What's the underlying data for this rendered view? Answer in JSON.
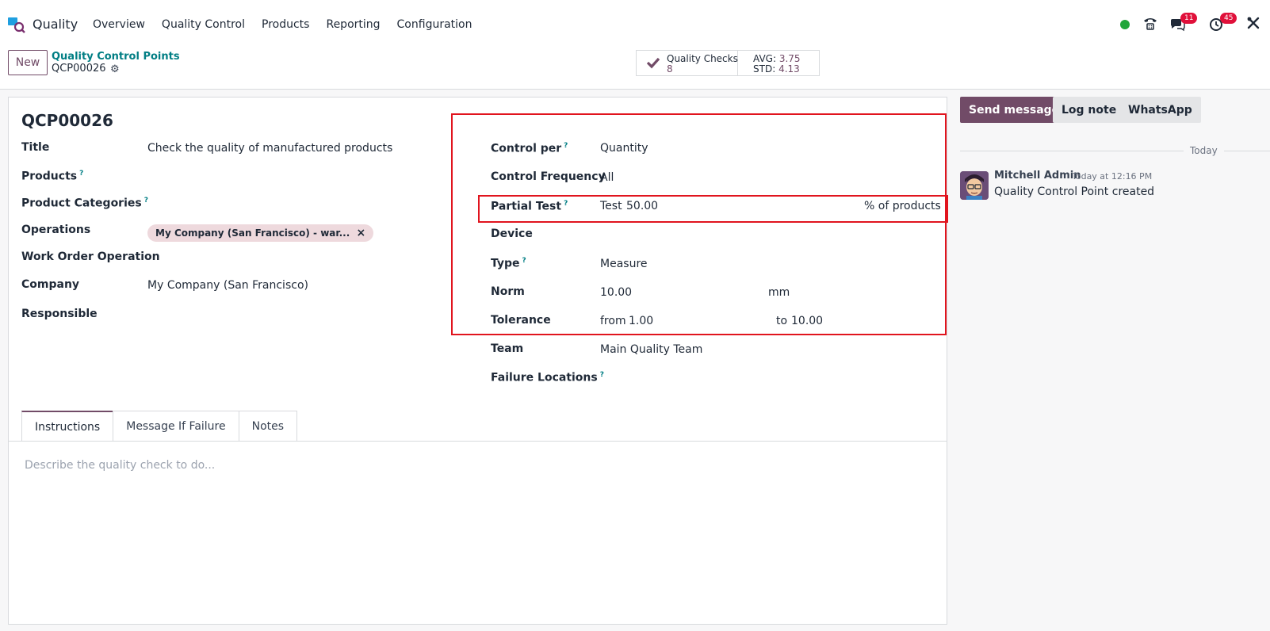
{
  "navbar": {
    "app_name": "Quality",
    "menu": [
      "Overview",
      "Quality Control",
      "Products",
      "Reporting",
      "Configuration"
    ],
    "messages_badge": "11",
    "activities_badge": "45",
    "status_color": "#21a63a"
  },
  "control_panel": {
    "new_label": "New",
    "breadcrumb_parent": "Quality Control Points",
    "breadcrumb_current": "QCP00026",
    "smart_button": {
      "label": "Quality Checks",
      "count": "8",
      "avg_label": "AVG:",
      "avg_value": "3.75",
      "std_label": "STD:",
      "std_value": "4.13"
    }
  },
  "form": {
    "record_title": "QCP00026",
    "left": {
      "title_label": "Title",
      "title_value": "Check the quality of manufactured products",
      "products_label": "Products",
      "product_categories_label": "Product Categories",
      "operations_label": "Operations",
      "operations_tag": "My Company (San Francisco) - war...",
      "work_order_operation_label": "Work Order Operation",
      "company_label": "Company",
      "company_value": "My Company (San Francisco)",
      "responsible_label": "Responsible"
    },
    "right": {
      "control_per_label": "Control per",
      "control_per_value": "Quantity",
      "control_frequency_label": "Control Frequency",
      "control_frequency_value": "All",
      "partial_test_label": "Partial Test",
      "partial_test_prefix": "Test",
      "partial_test_value": "50.00",
      "partial_test_suffix": "% of products",
      "device_label": "Device",
      "type_label": "Type",
      "type_value": "Measure",
      "norm_label": "Norm",
      "norm_value": "10.00",
      "norm_unit": "mm",
      "tolerance_label": "Tolerance",
      "tolerance_from_label": "from",
      "tolerance_from_value": "1.00",
      "tolerance_to_label": "to",
      "tolerance_to_value": "10.00",
      "team_label": "Team",
      "team_value": "Main Quality Team",
      "failure_locations_label": "Failure Locations"
    },
    "help_mark": "?",
    "tabs": [
      "Instructions",
      "Message If Failure",
      "Notes"
    ],
    "instructions_placeholder": "Describe the quality check to do..."
  },
  "chatter": {
    "send_message": "Send message",
    "log_note": "Log note",
    "whatsapp": "WhatsApp",
    "date_separator": "Today",
    "message": {
      "author": "Mitchell Admin",
      "time": "Today at 12:16 PM",
      "body": "Quality Control Point created"
    }
  },
  "colors": {
    "brand": "#714b67",
    "link": "#017e84",
    "highlight": "#e1141e"
  }
}
